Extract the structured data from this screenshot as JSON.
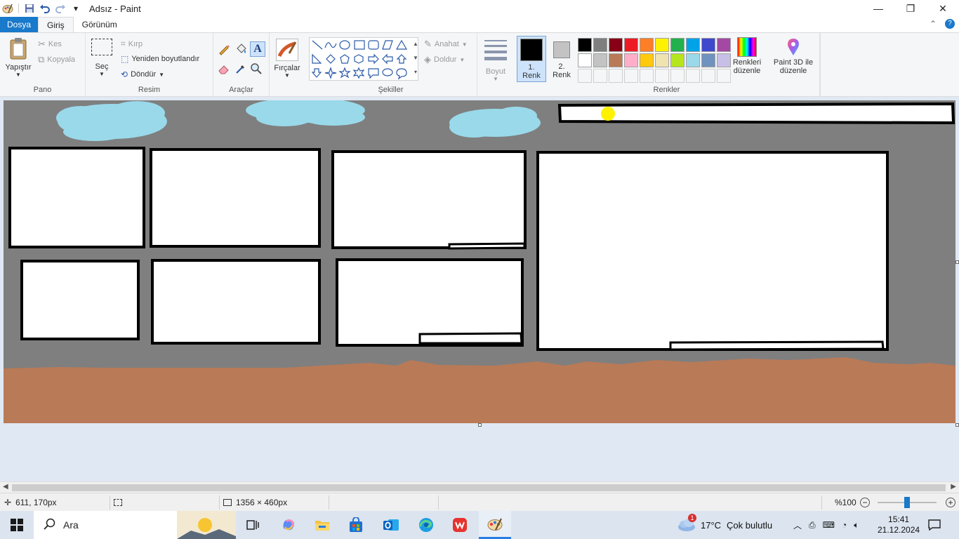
{
  "window": {
    "title": "Adsız - Paint",
    "controls": {
      "minimize": "—",
      "maximize": "❐",
      "close": "✕"
    }
  },
  "quick_access": {
    "dropdown": "▾"
  },
  "menu": {
    "tabs": [
      {
        "label": "Dosya"
      },
      {
        "label": "Giriş"
      },
      {
        "label": "Görünüm"
      }
    ],
    "collapse_icon": "⌃",
    "help_icon": "?"
  },
  "ribbon": {
    "pano": {
      "group_label": "Pano",
      "paste": "Yapıştır",
      "cut": "Kes",
      "copy": "Kopyala"
    },
    "resim": {
      "group_label": "Resim",
      "select": "Seç",
      "crop": "Kırp",
      "resize": "Yeniden boyutlandır",
      "rotate": "Döndür"
    },
    "araclar": {
      "group_label": "Araçlar"
    },
    "brushes": {
      "label": "Fırçalar"
    },
    "sekiller": {
      "group_label": "Şekiller",
      "outline": "Anahat",
      "fill": "Doldur"
    },
    "size": {
      "label": "Boyut"
    },
    "renkler": {
      "group_label": "Renkler",
      "color1": "1. Renk",
      "color1_value": "#000000",
      "color2": "2. Renk",
      "color2_value": "#c3c3c3",
      "edit_colors": "Renkleri düzenle",
      "paint3d": "Paint 3D ile düzenle",
      "palette": [
        "#000000",
        "#7f7f7f",
        "#880015",
        "#ed1c24",
        "#ff7f27",
        "#fff200",
        "#22b14c",
        "#00a2e8",
        "#3f48cc",
        "#a349a4",
        "#ffffff",
        "#c3c3c3",
        "#b97a57",
        "#ffaec9",
        "#ffc90e",
        "#efe4b0",
        "#b5e61d",
        "#99d9ea",
        "#7092be",
        "#c8bfe7"
      ]
    }
  },
  "canvas": {
    "background": "#7f7f7f",
    "ground_color": "#b97a57",
    "cloud_color": "#99d9ea",
    "sun_color": "#fff200"
  },
  "status": {
    "cursor_pos": "611, 170px",
    "canvas_size": "1356 × 460px",
    "zoom": "%100",
    "zoom_level_percent": 100
  },
  "taskbar": {
    "search_placeholder": "Ara",
    "weather_temp": "17°C",
    "weather_text": "Çok bulutlu",
    "weather_badge": "1",
    "time": "15:41",
    "date": "21.12.2024"
  }
}
